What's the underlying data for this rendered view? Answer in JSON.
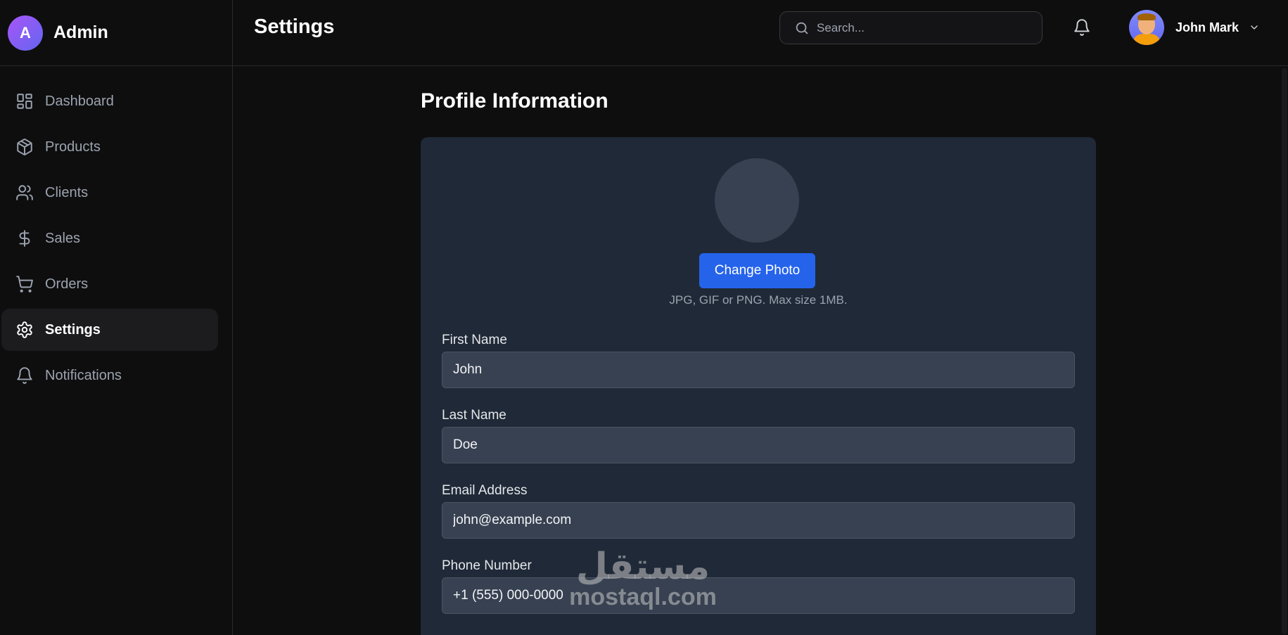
{
  "brand": {
    "badge": "A",
    "name": "Admin"
  },
  "sidebar": {
    "items": [
      {
        "label": "Dashboard",
        "icon": "dashboard-icon",
        "active": false
      },
      {
        "label": "Products",
        "icon": "box-icon",
        "active": false
      },
      {
        "label": "Clients",
        "icon": "users-icon",
        "active": false
      },
      {
        "label": "Sales",
        "icon": "dollar-icon",
        "active": false
      },
      {
        "label": "Orders",
        "icon": "cart-icon",
        "active": false
      },
      {
        "label": "Settings",
        "icon": "gear-icon",
        "active": true
      },
      {
        "label": "Notifications",
        "icon": "bell-icon",
        "active": false
      }
    ]
  },
  "header": {
    "title": "Settings",
    "search_placeholder": "Search...",
    "user_name": "John Mark"
  },
  "profile": {
    "title": "Profile Information",
    "change_photo_label": "Change Photo",
    "photo_hint": "JPG, GIF or PNG. Max size 1MB.",
    "fields": [
      {
        "label": "First Name",
        "value": "John"
      },
      {
        "label": "Last Name",
        "value": "Doe"
      },
      {
        "label": "Email Address",
        "value": "john@example.com"
      },
      {
        "label": "Phone Number",
        "value": "+1 (555) 000-0000"
      }
    ]
  },
  "watermark": {
    "arabic": "مستقل",
    "latin": "mostaql.com"
  },
  "colors": {
    "accent": "#2563eb",
    "card": "#1f2937",
    "background": "#0e0e0f",
    "brand_gradient_start": "#a855f7",
    "brand_gradient_end": "#6366f1"
  }
}
